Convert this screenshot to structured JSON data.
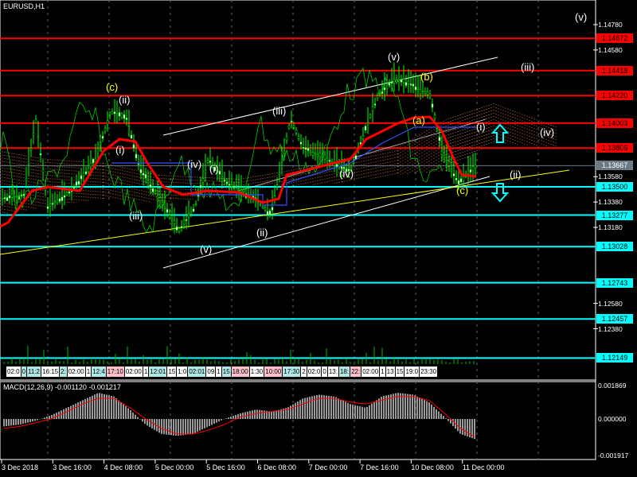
{
  "header": {
    "symbol_title": "EURUSD,H1"
  },
  "colors": {
    "resistance": "#ff0000",
    "support": "#00ffff",
    "current": "#6c7a86",
    "candle": "#00ff00",
    "ma": "#ff0000",
    "macd_hist": "#c0c0c0",
    "macd_signal": "#ff0000",
    "trend_white": "#ffffff",
    "trend_yellow": "#ffff00"
  },
  "chart_data": {
    "type": "line",
    "title": "EURUSD,H1",
    "ylim": [
      1.1205,
      1.1492
    ],
    "price_ticks": [
      "1.14780",
      "1.14580",
      "1.13580",
      "1.13380",
      "1.13180",
      "1.12580",
      "1.12380"
    ],
    "resistance_levels": [
      "1.14672",
      "1.14418",
      "1.14220",
      "1.14003",
      "1.13806"
    ],
    "current_price": "1.13667",
    "support_levels": [
      "1.13500",
      "1.13277",
      "1.13028",
      "1.12743",
      "1.12457",
      "1.12149"
    ],
    "x_ticks": [
      "3 Dec 2018",
      "3 Dec 16:00",
      "4 Dec 08:00",
      "5 Dec 00:00",
      "5 Dec 16:00",
      "6 Dec 08:00",
      "7 Dec 00:00",
      "7 Dec 16:00",
      "10 Dec 08:00",
      "11 Dec 00:00"
    ],
    "time_markers": [
      "02:0",
      "0",
      "11:2",
      "16:15",
      "2:",
      "02:00",
      "1",
      "12:4",
      "17:10",
      "02:00",
      "1",
      "12:01",
      "15",
      "1:0",
      "02:01",
      "09",
      "1",
      "15",
      "18:00",
      "1:30",
      "10:00",
      "17:30",
      "2",
      "02:0",
      "0",
      "13:",
      "18:",
      "22:",
      "02:00",
      "1",
      "13",
      "15",
      "19:0",
      "23:30"
    ],
    "wave_labels": [
      "(v)",
      "(c)",
      "(ii)",
      "(i)",
      "(iv)",
      "(i)",
      "(iii)",
      "(v)",
      "(ii)",
      "(iii)",
      "(iv)",
      "(v)",
      "(b)",
      "(a)",
      "(i)",
      "(iii)",
      "(iv)",
      "(ii)",
      "(c)"
    ],
    "macd": {
      "label": "MACD(12,26,9) -0.001120 -0.001217",
      "ticks": [
        "0.001869",
        "0.000000",
        "-0.001917"
      ],
      "ylim": [
        -0.001917,
        0.001869
      ],
      "hist_profile": [
        -0.0004,
        -0.0003,
        -0.0001,
        0.0002,
        0.0006,
        0.001,
        0.0014,
        0.0012,
        0.0005,
        -0.0003,
        -0.0008,
        -0.0009,
        -0.0008,
        -0.0004,
        0.0,
        0.0003,
        0.0005,
        0.0004,
        0.0006,
        0.0011,
        0.0013,
        0.0012,
        0.0008,
        0.0006,
        0.0012,
        0.0014,
        0.0013,
        0.0009,
        0.0001,
        -0.0008,
        -0.0011
      ],
      "signal_profile": [
        -0.0005,
        -0.0004,
        -0.0002,
        0.0,
        0.0004,
        0.0008,
        0.0011,
        0.0011,
        0.0006,
        0.0,
        -0.0005,
        -0.0008,
        -0.0008,
        -0.0006,
        -0.0003,
        0.0001,
        0.0003,
        0.0004,
        0.0005,
        0.0008,
        0.0011,
        0.0011,
        0.0009,
        0.0008,
        0.001,
        0.0012,
        0.0012,
        0.001,
        0.0003,
        -0.0005,
        -0.001
      ]
    }
  }
}
